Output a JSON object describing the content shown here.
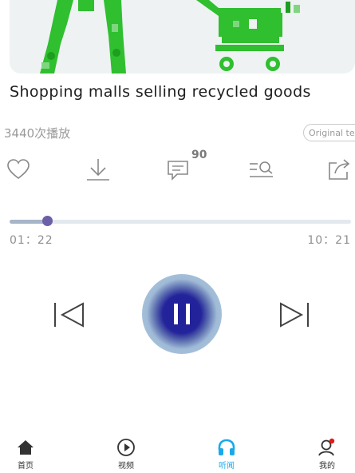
{
  "article": {
    "title": "Shopping malls selling recycled goods",
    "play_count": "3440次播放",
    "original_badge": "Original tex"
  },
  "actions": {
    "comment_count": "90"
  },
  "player": {
    "elapsed": "01：22",
    "duration": "10：21",
    "progress": 0.11,
    "state": "playing"
  },
  "tabbar": {
    "items": [
      {
        "label": "首页",
        "icon": "home-icon"
      },
      {
        "label": "视频",
        "icon": "video-play-icon"
      },
      {
        "label": "听闻",
        "icon": "headphones-icon",
        "active": true
      },
      {
        "label": "我的",
        "icon": "user-profile-icon"
      }
    ]
  },
  "colors": {
    "accent": "#1aa9e8",
    "play_button": "#23239a",
    "cover_icons": "#2fbf2f"
  }
}
